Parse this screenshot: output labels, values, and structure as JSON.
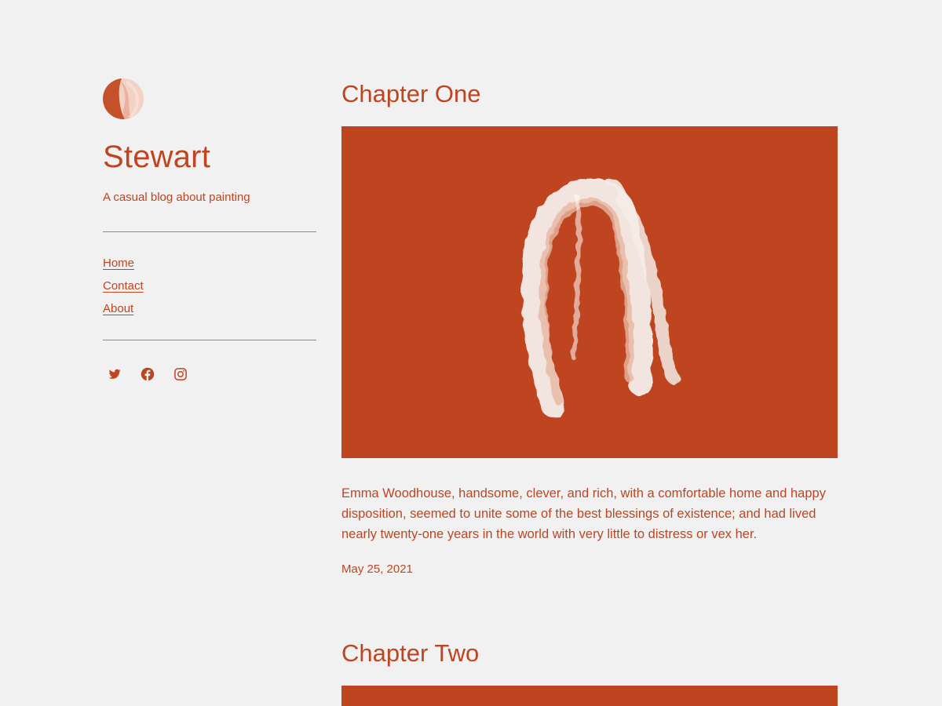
{
  "site": {
    "title": "Stewart",
    "tagline": "A casual blog about painting",
    "logo_icon": "brush-circle-logo-icon",
    "accent_color": "#bf4520",
    "background_color": "#f0f1f0"
  },
  "nav": {
    "items": [
      {
        "label": "Home"
      },
      {
        "label": "Contact"
      },
      {
        "label": "About"
      }
    ]
  },
  "social": [
    {
      "icon": "twitter-icon"
    },
    {
      "icon": "facebook-icon"
    },
    {
      "icon": "instagram-icon"
    }
  ],
  "posts": [
    {
      "title": "Chapter One",
      "excerpt": "Emma Woodhouse, handsome, clever, and rich, with a comfortable home and happy disposition, seemed to unite some of the best blessings of existence; and had lived nearly twenty-one years in the world with very little to distress or vex her.",
      "date": "May 25, 2021",
      "image": "brush-stroke-arch"
    },
    {
      "title": "Chapter Two",
      "image": "orange-block"
    }
  ]
}
